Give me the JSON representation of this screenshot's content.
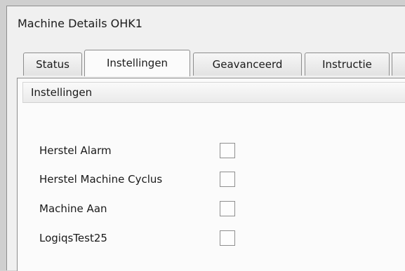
{
  "window": {
    "title": "Machine Details OHK1"
  },
  "tabs": [
    {
      "label": "Status",
      "active": false
    },
    {
      "label": "Instellingen",
      "active": true
    },
    {
      "label": "Geavanceerd",
      "active": false
    },
    {
      "label": "Instructie",
      "active": false
    }
  ],
  "panel": {
    "header": "Instellingen",
    "settings": [
      {
        "label": "Herstel Alarm",
        "checked": false
      },
      {
        "label": "Herstel Machine Cyclus",
        "checked": false
      },
      {
        "label": "Machine Aan",
        "checked": false
      },
      {
        "label": "LogiqsTest25",
        "checked": false
      }
    ]
  }
}
